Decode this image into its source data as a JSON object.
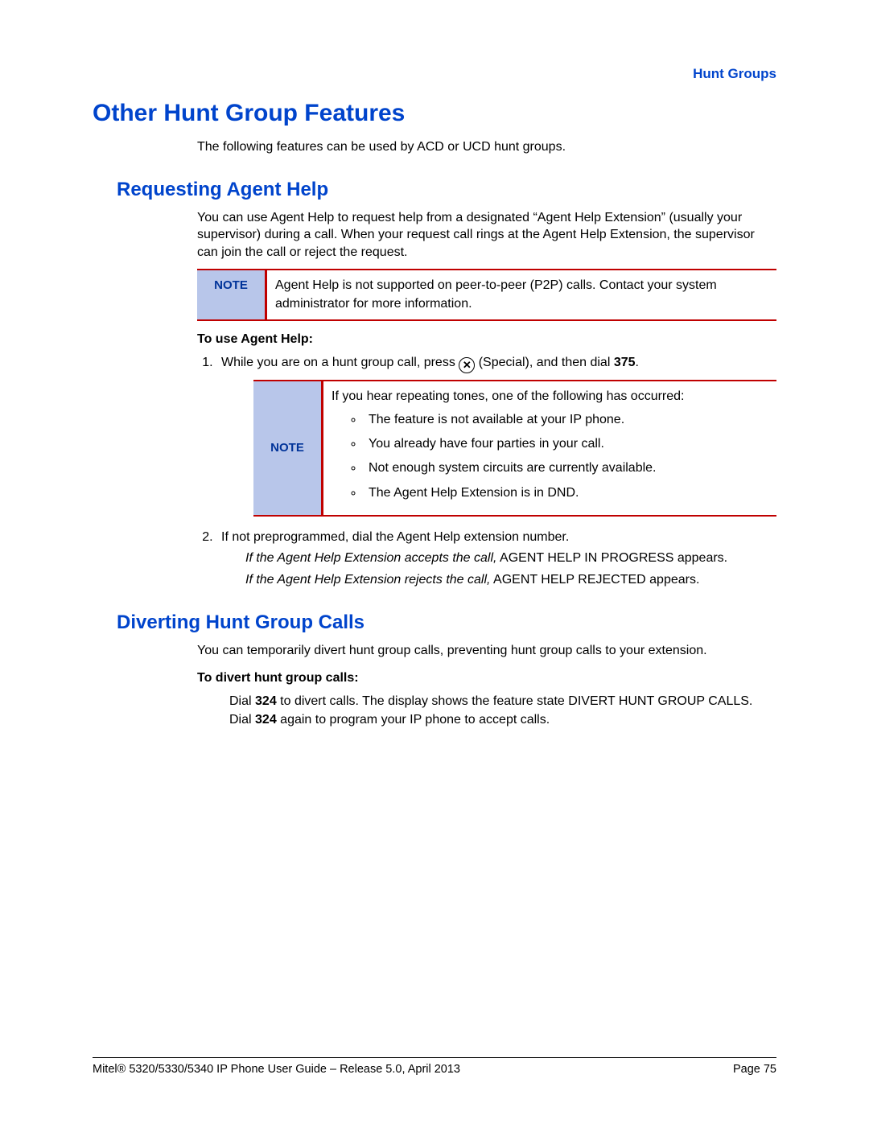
{
  "runHead": "Hunt Groups",
  "h1": "Other Hunt Group Features",
  "intro": "The following features can be used by ACD or UCD hunt groups.",
  "sec1": {
    "title": "Requesting Agent Help",
    "para": "You can use Agent Help to request help from a designated “Agent Help Extension” (usually your supervisor) during a call. When your request call rings at the Agent Help Extension, the supervisor can join the call or reject the request.",
    "note1Label": "NOTE",
    "note1Body": "Agent Help is not supported on peer-to-peer (P2P) calls. Contact your system administrator for more information.",
    "lead": "To use Agent Help:",
    "step1a": "While you are on a hunt group call, press ",
    "step1b": " (Special), and then dial ",
    "step1code": "375",
    "step1c": ".",
    "note2Label": "NOTE",
    "note2Intro": "If you hear repeating tones, one of the following has occurred:",
    "note2Bullets": [
      "The feature is not available at your IP phone.",
      "You already have four parties in your call.",
      "Not enough system circuits are currently available.",
      "The Agent Help Extension is in DND."
    ],
    "step2": "If not preprogrammed, dial the Agent Help extension number.",
    "accA": "If the Agent Help Extension accepts the call,",
    "accB": " AGENT HELP IN PROGRESS appears.",
    "rejA": "If the Agent Help Extension rejects the call,",
    "rejB": " AGENT HELP REJECTED appears."
  },
  "sec2": {
    "title": "Diverting Hunt Group Calls",
    "para": "You can temporarily divert hunt group calls, preventing hunt group calls to your extension.",
    "lead": "To divert hunt group calls:",
    "dialA": "Dial ",
    "code1": "324",
    "dialB": " to divert calls. The display shows the feature state DIVERT HUNT GROUP CALLS. Dial ",
    "code2": "324",
    "dialC": " again to program your IP phone to accept calls."
  },
  "footer": {
    "left": "Mitel® 5320/5330/5340 IP Phone User Guide – Release 5.0, April 2013",
    "right": "Page 75"
  }
}
